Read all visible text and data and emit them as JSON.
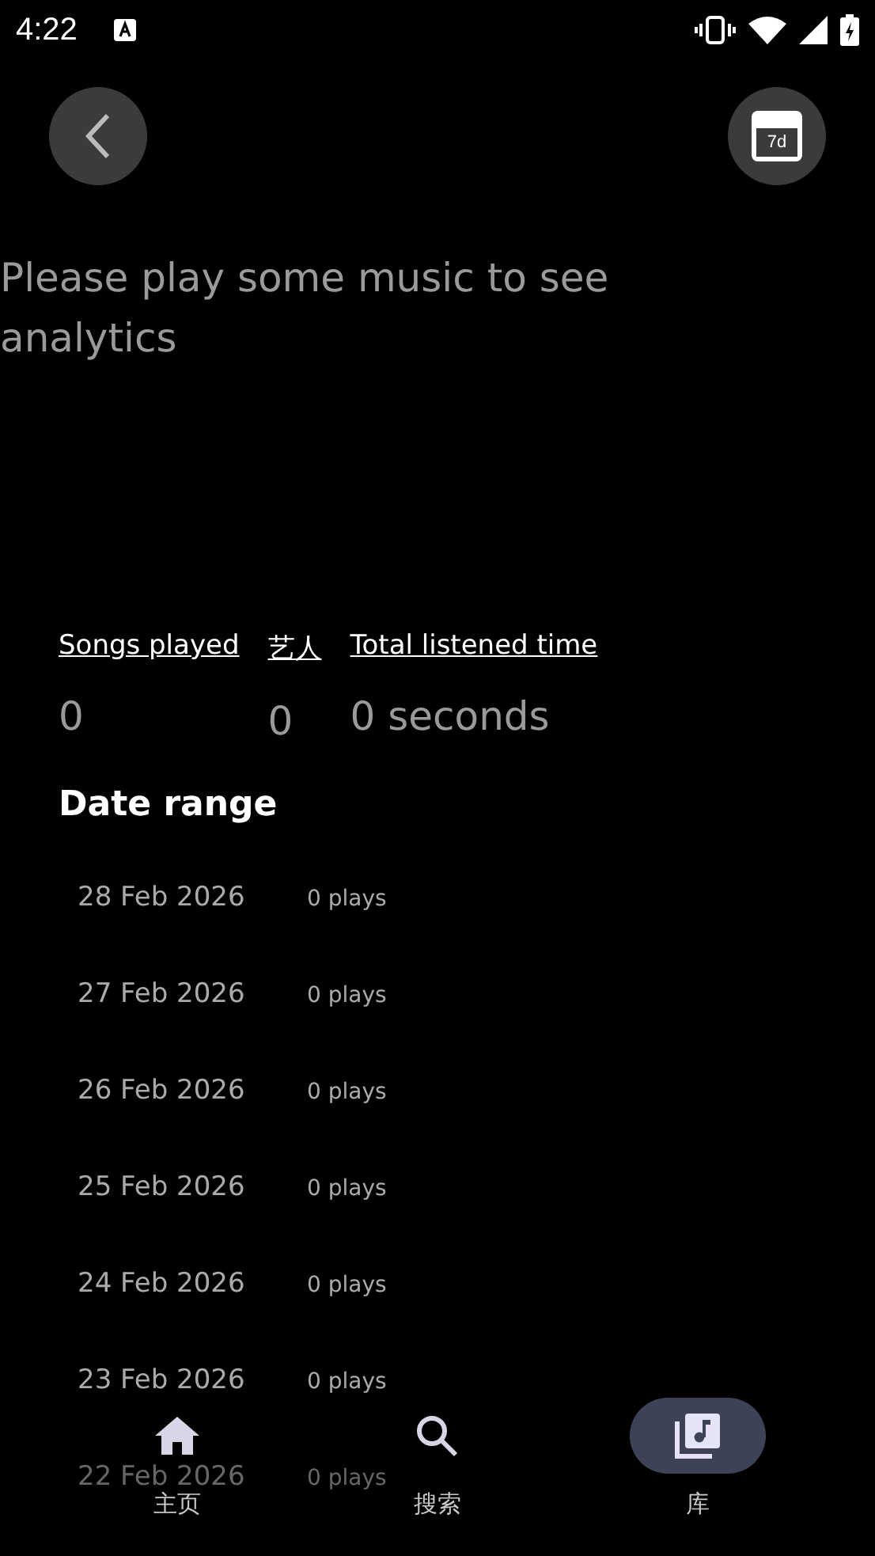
{
  "status_bar": {
    "time": "4:22"
  },
  "header": {
    "calendar_badge": "7d"
  },
  "message": "Please play some music to see analytics",
  "stats": [
    {
      "label": "Songs played",
      "value": "0"
    },
    {
      "label": "艺人",
      "value": "0"
    },
    {
      "label": "Total listened time",
      "value": "0 seconds"
    }
  ],
  "date_range": {
    "title": "Date range",
    "rows": [
      {
        "date": "28 Feb 2026",
        "plays": "0 plays"
      },
      {
        "date": "27 Feb 2026",
        "plays": "0 plays"
      },
      {
        "date": "26 Feb 2026",
        "plays": "0 plays"
      },
      {
        "date": "25 Feb 2026",
        "plays": "0 plays"
      },
      {
        "date": "24 Feb 2026",
        "plays": "0 plays"
      },
      {
        "date": "23 Feb 2026",
        "plays": "0 plays"
      },
      {
        "date": "22 Feb 2026",
        "plays": "0 plays"
      }
    ]
  },
  "bottom_nav": [
    {
      "kind": "home",
      "label": "主页",
      "selected": false
    },
    {
      "kind": "search",
      "label": "搜索",
      "selected": false
    },
    {
      "kind": "library",
      "label": "库",
      "selected": true
    }
  ]
}
